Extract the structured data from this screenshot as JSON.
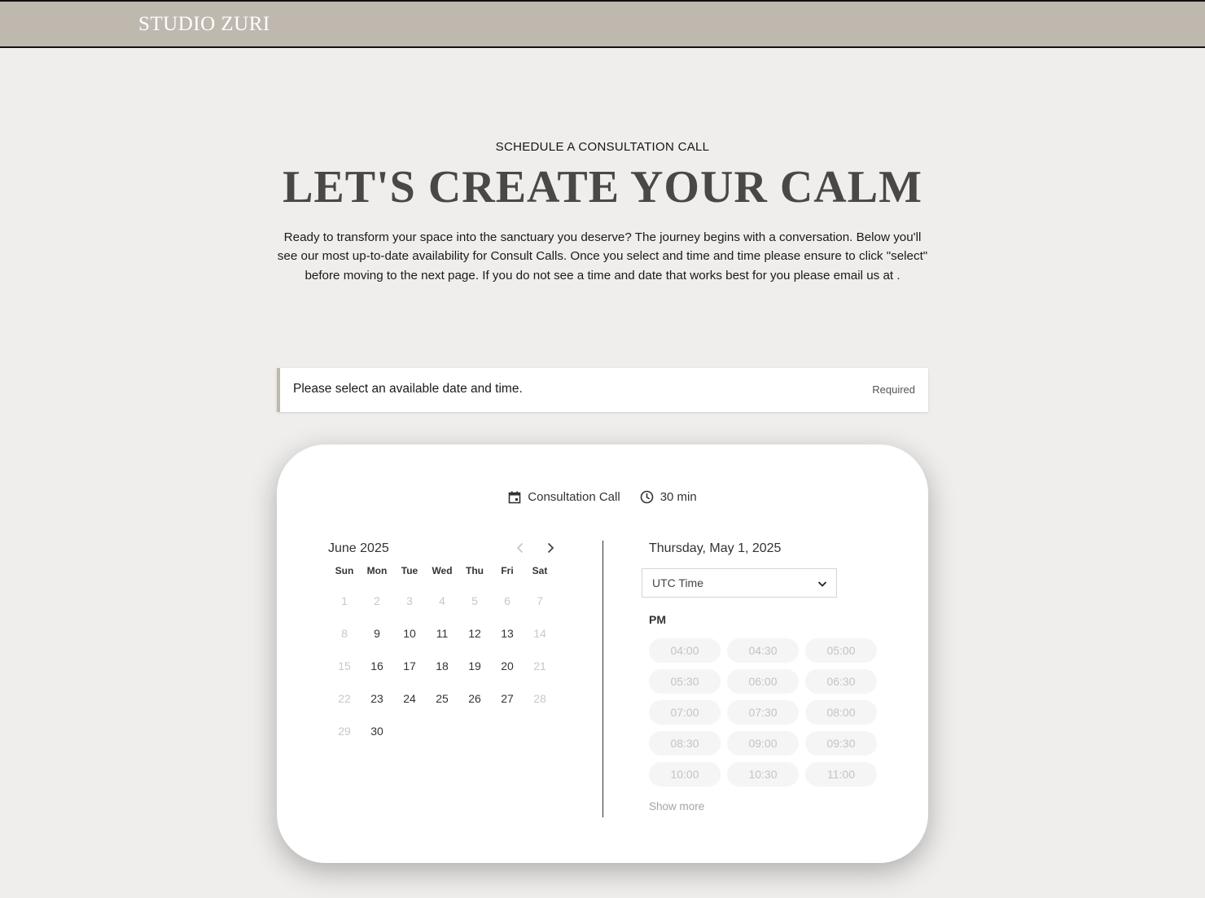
{
  "header": {
    "brand": "STUDIO ZURI",
    "brand_color": "#ffffff",
    "bar_color": "#bfb8ae"
  },
  "hero": {
    "eyebrow": "SCHEDULE A CONSULTATION CALL",
    "title": "LET'S CREATE YOUR CALM",
    "intro": "Ready to transform your space into the sanctuary you deserve? The journey begins with a conversation. Below you'll see our most up-to-date availability for Consult Calls. Once you select and time and time please ensure to click \"select\" before moving to the next page. If you do not see a time and date that works best for you please email us at ."
  },
  "notice": {
    "text": "Please select an available date and time.",
    "required": "Required"
  },
  "booking": {
    "service_icon": "calendar-icon",
    "service": "Consultation Call",
    "duration_icon": "clock-icon",
    "duration": "30 min",
    "calendar": {
      "month": "June 2025",
      "prev_icon": "chevron-left-icon",
      "next_icon": "chevron-right-icon",
      "weekdays": [
        "Sun",
        "Mon",
        "Tue",
        "Wed",
        "Thu",
        "Fri",
        "Sat"
      ],
      "days": [
        {
          "label": "1",
          "available": false
        },
        {
          "label": "2",
          "available": false
        },
        {
          "label": "3",
          "available": false
        },
        {
          "label": "4",
          "available": false
        },
        {
          "label": "5",
          "available": false
        },
        {
          "label": "6",
          "available": false
        },
        {
          "label": "7",
          "available": false
        },
        {
          "label": "8",
          "available": false
        },
        {
          "label": "9",
          "available": true
        },
        {
          "label": "10",
          "available": true
        },
        {
          "label": "11",
          "available": true
        },
        {
          "label": "12",
          "available": true
        },
        {
          "label": "13",
          "available": true
        },
        {
          "label": "14",
          "available": false
        },
        {
          "label": "15",
          "available": false
        },
        {
          "label": "16",
          "available": true
        },
        {
          "label": "17",
          "available": true
        },
        {
          "label": "18",
          "available": true
        },
        {
          "label": "19",
          "available": true
        },
        {
          "label": "20",
          "available": true
        },
        {
          "label": "21",
          "available": false
        },
        {
          "label": "22",
          "available": false
        },
        {
          "label": "23",
          "available": true
        },
        {
          "label": "24",
          "available": true
        },
        {
          "label": "25",
          "available": true
        },
        {
          "label": "26",
          "available": true
        },
        {
          "label": "27",
          "available": true
        },
        {
          "label": "28",
          "available": false
        },
        {
          "label": "29",
          "available": false
        },
        {
          "label": "30",
          "available": true
        }
      ]
    },
    "selected_date": "Thursday, May 1, 2025",
    "timezone": {
      "value": "UTC Time",
      "icon": "chevron-down-icon"
    },
    "period": "PM",
    "slots": [
      "04:00",
      "04:30",
      "05:00",
      "05:30",
      "06:00",
      "06:30",
      "07:00",
      "07:30",
      "08:00",
      "08:30",
      "09:00",
      "09:30",
      "10:00",
      "10:30",
      "11:00"
    ],
    "show_more": "Show more"
  }
}
